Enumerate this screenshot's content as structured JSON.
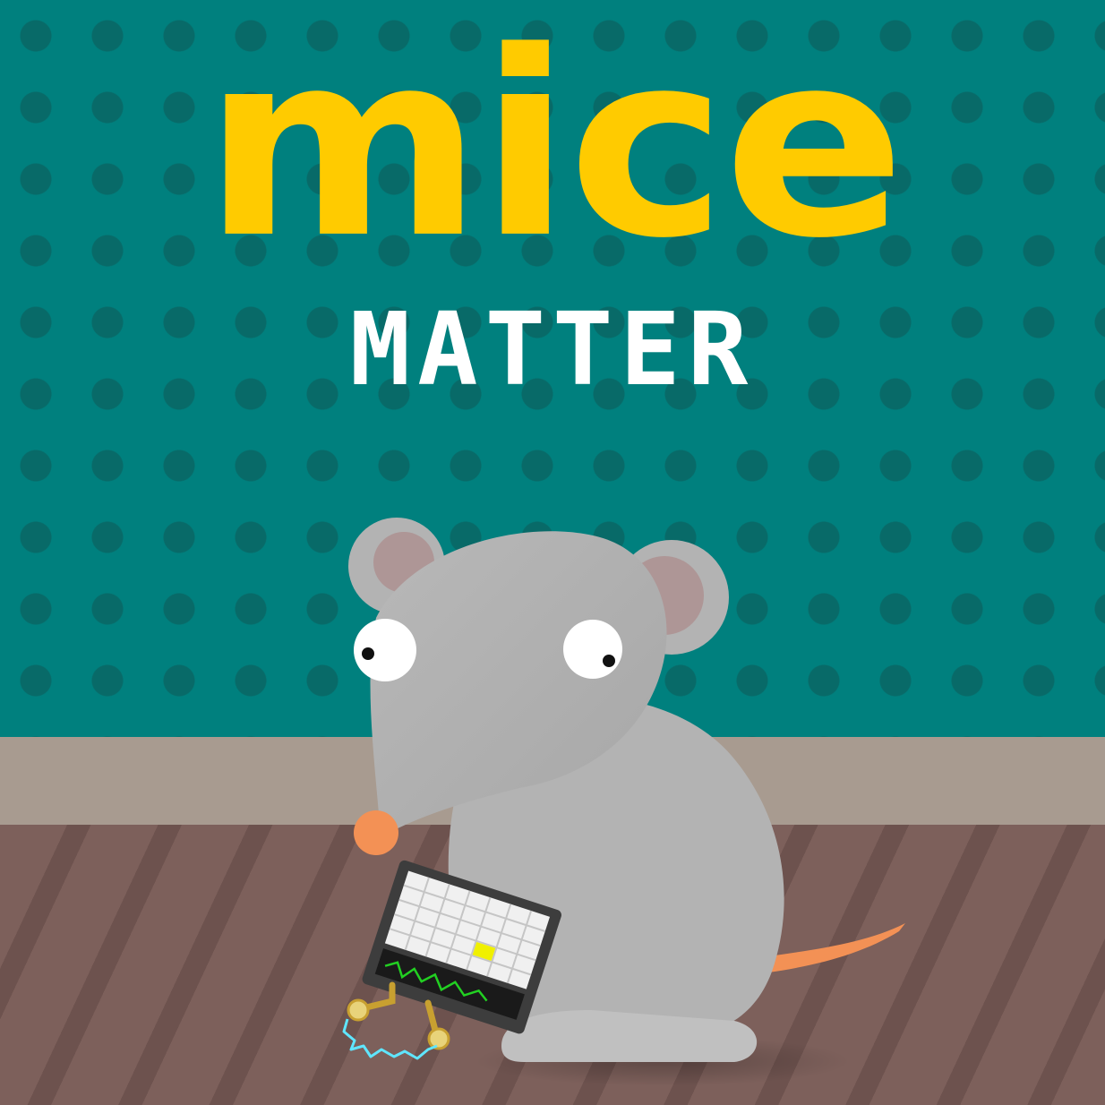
{
  "title": "mice",
  "subtitle": "MATTER",
  "colors": {
    "wall": "#00807e",
    "wall_dots": "#086a68",
    "title": "#ffcb00",
    "subtitle": "#ffffff",
    "baseboard": "#a89b90",
    "floor": "#7d605b",
    "floor_stripe": "#6d524e",
    "mouse_body": "#b3b3b3",
    "mouse_ear_inner": "#ae9696",
    "mouse_nose": "#f39155",
    "mouse_tail": "#f39155",
    "device_screen_highlight": "#f0f000",
    "device_wave": "#22d022"
  },
  "icons": {
    "mouse": "mouse-character",
    "device": "handheld-grid-device",
    "spark": "electric-spark-icon"
  }
}
